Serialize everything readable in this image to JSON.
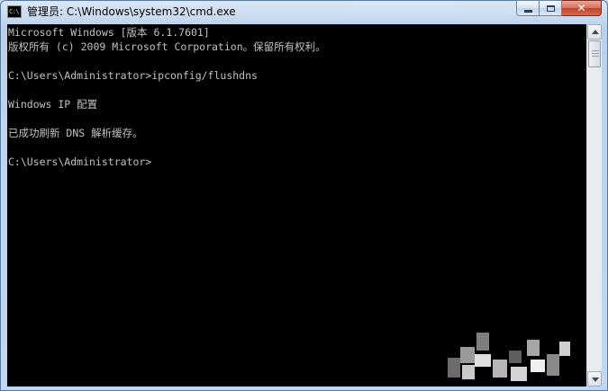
{
  "window": {
    "title": "管理员: C:\\Windows\\system32\\cmd.exe",
    "icon": "cmd-icon",
    "icon_text": "C:\\",
    "controls": {
      "minimize": "minimize-icon",
      "maximize": "maximize-icon",
      "close": "close-icon",
      "close_glyph": "✕"
    }
  },
  "console": {
    "lines": [
      "Microsoft Windows [版本 6.1.7601]",
      "版权所有 (c) 2009 Microsoft Corporation。保留所有权利。",
      "",
      "C:\\Users\\Administrator>ipconfig/flushdns",
      "",
      "Windows IP 配置",
      "",
      "已成功刷新 DNS 解析缓存。",
      "",
      "C:\\Users\\Administrator>"
    ]
  },
  "colors": {
    "console_bg": "#000000",
    "console_fg": "#c0c0c0",
    "close_button": "#c4412a"
  }
}
